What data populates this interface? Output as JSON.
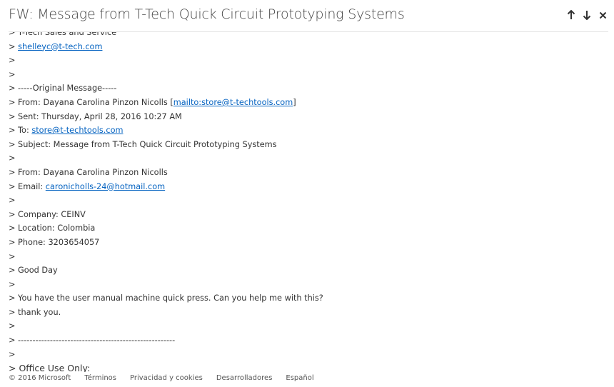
{
  "header": {
    "subject": "FW: Message from T-Tech Quick Circuit Prototyping Systems"
  },
  "icons": {
    "prev": "arrow-up-icon",
    "next": "arrow-down-icon",
    "close": "close-icon"
  },
  "body": {
    "clipped_line": "> T-Tech Sales and Service",
    "l1_prefix": "> ",
    "l1_link": "shelleyc@t-tech.com",
    "l2": ">",
    "l3": ">",
    "l4": "> -----Original Message-----",
    "l5_prefix": "> From: Dayana Carolina Pinzon Nicolls [",
    "l5_link": "mailto:store@t-techtools.com",
    "l5_suffix": "]",
    "l6": "> Sent: Thursday, April 28, 2016 10:27 AM",
    "l7_prefix": "> To: ",
    "l7_link": "store@t-techtools.com",
    "l8": "> Subject: Message from T-Tech Quick Circuit Prototyping Systems",
    "l9": ">",
    "l10": "> From: Dayana Carolina Pinzon Nicolls",
    "l11_prefix": "> Email: ",
    "l11_link": "caronicholls-24@hotmail.com",
    "l12": ">",
    "l13": "> Company: CEINV",
    "l14": "> Location: Colombia",
    "l15": "> Phone: 3203654057",
    "l16": ">",
    "l17": "> Good Day",
    "l18": ">",
    "l19": "> You have the user manual machine quick press. Can you help me with this?",
    "l20": "> thank you.",
    "l21": ">",
    "l22": "> ------------------------------------------------------",
    "l23": ">",
    "l24": "> Office Use Only:"
  },
  "footer": {
    "copyright": "© 2016 Microsoft",
    "terms": "Términos",
    "privacy": "Privacidad y cookies",
    "developers": "Desarrolladores",
    "language": "Español"
  }
}
